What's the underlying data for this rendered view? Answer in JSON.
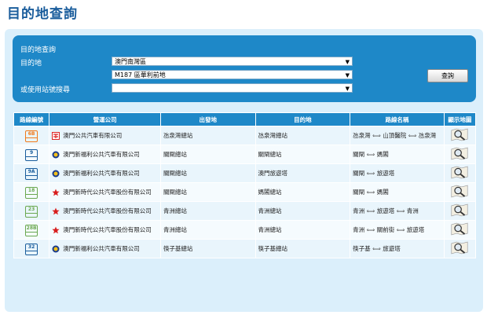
{
  "page": {
    "title": "目的地查詢"
  },
  "search": {
    "panel_title": "目的地查詢",
    "dest_label": "目的地",
    "dest_value": "澳門南灣區",
    "stop_value": "M187 區華利前地",
    "station_label": "或使用站號搜尋",
    "station_value": "",
    "button_label": "查詢"
  },
  "table": {
    "headers": [
      "路線編號",
      "營運公司",
      "出發地",
      "目的地",
      "路線名稱",
      "顯示地圖"
    ],
    "rows": [
      {
        "route": "6B",
        "badge_color": "#f07a1a",
        "company": "澳門公共汽車有限公司",
        "company_icon": "tcm-logo",
        "origin": "氹泉灣總站",
        "dest": "氹泉灣總站",
        "name": [
          "氹泉灣",
          "山頂醫院",
          "氹泉灣"
        ]
      },
      {
        "route": "9",
        "badge_color": "#1a5d9c",
        "company": "澳門新福利公共汽車有限公司",
        "company_icon": "transmac-logo",
        "origin": "關閘總站",
        "dest": "關閘總站",
        "name": [
          "關閘",
          "媽閣"
        ]
      },
      {
        "route": "9A",
        "badge_color": "#1a5d9c",
        "company": "澳門新福利公共汽車有限公司",
        "company_icon": "transmac-logo",
        "origin": "關閘總站",
        "dest": "澳門旅遊塔",
        "name": [
          "關閘",
          "旅遊塔"
        ]
      },
      {
        "route": "18",
        "badge_color": "#6aa84f",
        "company": "澳門新時代公共汽車股份有限公司",
        "company_icon": "newera-logo",
        "origin": "關閘總站",
        "dest": "媽閣總站",
        "name": [
          "關閘",
          "媽閣"
        ]
      },
      {
        "route": "23",
        "badge_color": "#6aa84f",
        "company": "澳門新時代公共汽車股份有限公司",
        "company_icon": "newera-logo",
        "origin": "青洲總站",
        "dest": "青洲總站",
        "name": [
          "青洲",
          "旅遊塔",
          "青洲"
        ]
      },
      {
        "route": "28B",
        "badge_color": "#6aa84f",
        "company": "澳門新時代公共汽車股份有限公司",
        "company_icon": "newera-logo",
        "origin": "青洲總站",
        "dest": "青洲總站",
        "name": [
          "青洲",
          "關前街",
          "旅遊塔"
        ]
      },
      {
        "route": "32",
        "badge_color": "#1a5d9c",
        "company": "澳門新福利公共汽車有限公司",
        "company_icon": "transmac-logo",
        "origin": "筷子基總站",
        "dest": "筷子基總站",
        "name": [
          "筷子基",
          "旅遊塔"
        ]
      }
    ]
  }
}
